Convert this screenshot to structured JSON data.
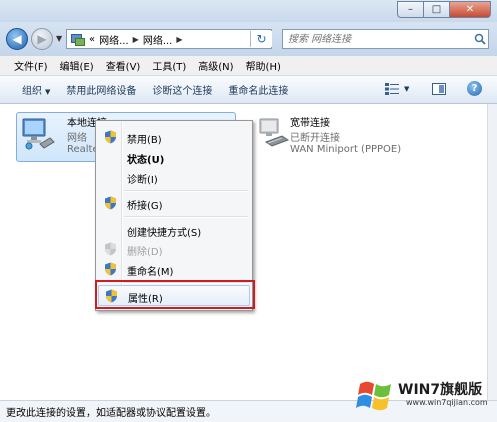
{
  "addressbar": {
    "crumbs": [
      "«",
      "网络...",
      "网络..."
    ],
    "search_placeholder": "搜索 网络连接"
  },
  "window_controls": {
    "minimize": "–",
    "maximize": "□",
    "close": "✕"
  },
  "menubar": {
    "items": [
      "文件(F)",
      "编辑(E)",
      "查看(V)",
      "工具(T)",
      "高级(N)",
      "帮助(H)"
    ]
  },
  "toolbar": {
    "organize": "组织",
    "disable_device": "禁用此网络设备",
    "diagnose": "诊断这个连接",
    "rename": "重命名此连接",
    "help": "?"
  },
  "connections": [
    {
      "name": "本地连接",
      "status": "网络",
      "device": "Realte"
    },
    {
      "name": "宽带连接",
      "status": "已断开连接",
      "device": "WAN Miniport (PPPOE)"
    }
  ],
  "context_menu": {
    "items": [
      {
        "label": "禁用(B)",
        "shield": true,
        "bold": false,
        "disabled": false
      },
      {
        "label": "状态(U)",
        "shield": false,
        "bold": true,
        "disabled": false
      },
      {
        "label": "诊断(I)",
        "shield": false,
        "bold": false,
        "disabled": false
      },
      {
        "label": "桥接(G)",
        "shield": true,
        "bold": false,
        "disabled": false
      },
      {
        "label": "创建快捷方式(S)",
        "shield": false,
        "bold": false,
        "disabled": false
      },
      {
        "label": "删除(D)",
        "shield": true,
        "bold": false,
        "disabled": true
      },
      {
        "label": "重命名(M)",
        "shield": true,
        "bold": false,
        "disabled": false
      },
      {
        "label": "属性(R)",
        "shield": true,
        "bold": false,
        "disabled": false
      }
    ]
  },
  "statusbar": {
    "text": "更改此连接的设置，如适配器或协议配置设置。"
  },
  "watermark": {
    "brand": "WIN7旗舰版",
    "url": "www.win7qijian.com"
  },
  "colors": {
    "highlight_border": "#d11b22",
    "selection_bg": "#cfe6fb"
  }
}
